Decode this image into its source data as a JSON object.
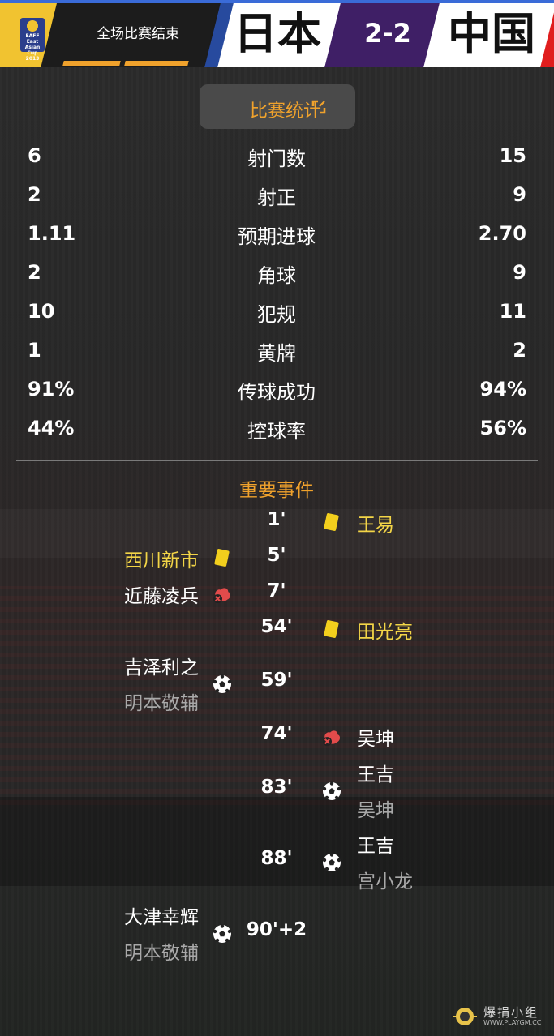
{
  "header": {
    "logo_text": "EAFF East Asian Cup 2013",
    "match_status": "全场比赛结束",
    "home_team": "日本",
    "score": "2-2",
    "away_team": "中国"
  },
  "stats_button": {
    "label": "比赛统计",
    "icon": "expand-icon"
  },
  "stats": [
    {
      "label": "射门数",
      "home": "6",
      "away": "15"
    },
    {
      "label": "射正",
      "home": "2",
      "away": "9"
    },
    {
      "label": "预期进球",
      "home": "1.11",
      "away": "2.70"
    },
    {
      "label": "角球",
      "home": "2",
      "away": "9"
    },
    {
      "label": "犯规",
      "home": "10",
      "away": "11"
    },
    {
      "label": "黄牌",
      "home": "1",
      "away": "2"
    },
    {
      "label": "传球成功",
      "home": "91%",
      "away": "94%"
    },
    {
      "label": "控球率",
      "home": "44%",
      "away": "56%"
    }
  ],
  "events_title": "重要事件",
  "events": [
    {
      "minute": "1'",
      "side": "away",
      "type": "yellow-card",
      "player": "王易",
      "sub": ""
    },
    {
      "minute": "5'",
      "side": "home",
      "type": "yellow-card",
      "player": "西川新市",
      "sub": ""
    },
    {
      "minute": "7'",
      "side": "home",
      "type": "injury",
      "player": "近藤凌兵",
      "sub": ""
    },
    {
      "minute": "54'",
      "side": "away",
      "type": "yellow-card",
      "player": "田光亮",
      "sub": ""
    },
    {
      "minute": "59'",
      "side": "home",
      "type": "goal",
      "player": "吉泽利之",
      "sub": "明本敬辅"
    },
    {
      "minute": "74'",
      "side": "away",
      "type": "injury",
      "player": "吴坤",
      "sub": ""
    },
    {
      "minute": "83'",
      "side": "away",
      "type": "goal",
      "player": "王吉",
      "sub": "吴坤"
    },
    {
      "minute": "88'",
      "side": "away",
      "type": "goal",
      "player": "王吉",
      "sub": "宫小龙"
    },
    {
      "minute": "90'+2",
      "side": "home",
      "type": "goal",
      "player": "大津幸辉",
      "sub": "明本敬辅"
    }
  ],
  "watermark": {
    "text": "爆捐小组",
    "url": "WWW.PLAYGM.CC"
  },
  "colors": {
    "accent": "#f0a22c",
    "card": "#f2cf1d",
    "score_bg": "#3f1f66",
    "home_stripe": "#274a9e",
    "away_stripe": "#e01d1d"
  }
}
